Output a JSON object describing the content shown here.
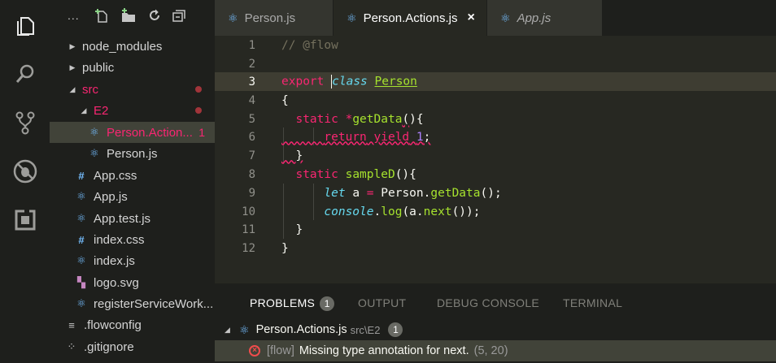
{
  "activity_bar": {
    "icons": [
      "files-icon",
      "search-icon",
      "source-control-icon",
      "debug-icon",
      "extensions-icon"
    ]
  },
  "explorer": {
    "toolbar_more": "...",
    "items": [
      {
        "label": "node_modules",
        "type": "folder",
        "expanded": false
      },
      {
        "label": "public",
        "type": "folder",
        "expanded": false
      },
      {
        "label": "src",
        "type": "folder",
        "expanded": true,
        "status": "error"
      },
      {
        "label": "E2",
        "type": "folder",
        "expanded": true,
        "status": "error"
      },
      {
        "label": "Person.Action...",
        "type": "react-file",
        "selected": true,
        "count": "1"
      },
      {
        "label": "Person.js",
        "type": "react-file"
      },
      {
        "label": "App.css",
        "type": "css"
      },
      {
        "label": "App.js",
        "type": "react-file"
      },
      {
        "label": "App.test.js",
        "type": "react-file"
      },
      {
        "label": "index.css",
        "type": "css"
      },
      {
        "label": "index.js",
        "type": "react-file"
      },
      {
        "label": "logo.svg",
        "type": "svg"
      },
      {
        "label": "registerServiceWork...",
        "type": "react-file"
      },
      {
        "label": ".flowconfig",
        "type": "config"
      },
      {
        "label": ".gitignore",
        "type": "config"
      }
    ]
  },
  "tabs": [
    {
      "label": "Person.js",
      "active": false
    },
    {
      "label": "Person.Actions.js",
      "active": true,
      "close": "×"
    },
    {
      "label": "App.js",
      "active": false,
      "italic": true
    }
  ],
  "editor": {
    "line_numbers": [
      "1",
      "2",
      "3",
      "4",
      "5",
      "6",
      "7",
      "8",
      "9",
      "10",
      "11",
      "12"
    ],
    "current_line": 3,
    "lines": [
      "// @flow",
      "",
      "export class Person",
      "{",
      "  static *getData(){",
      "      return yield 1;",
      "  }",
      "  static sampleD(){",
      "      let a = Person.getData();",
      "      console.log(a.next());",
      "  }",
      "}"
    ]
  },
  "panel": {
    "tabs": [
      {
        "label": "PROBLEMS",
        "badge": "1",
        "active": true
      },
      {
        "label": "OUTPUT"
      },
      {
        "label": "DEBUG CONSOLE"
      },
      {
        "label": "TERMINAL"
      }
    ],
    "file_group": {
      "file": "Person.Actions.js",
      "path": "src\\E2",
      "count": "1"
    },
    "problem": {
      "source": "[flow]",
      "message": "Missing type annotation for next.",
      "location": "(5, 20)"
    }
  },
  "colors": {
    "keyword": "#f92672",
    "comment": "#75715e",
    "function": "#a6e22e",
    "number": "#ae81ff",
    "storage": "#66d9ef"
  }
}
